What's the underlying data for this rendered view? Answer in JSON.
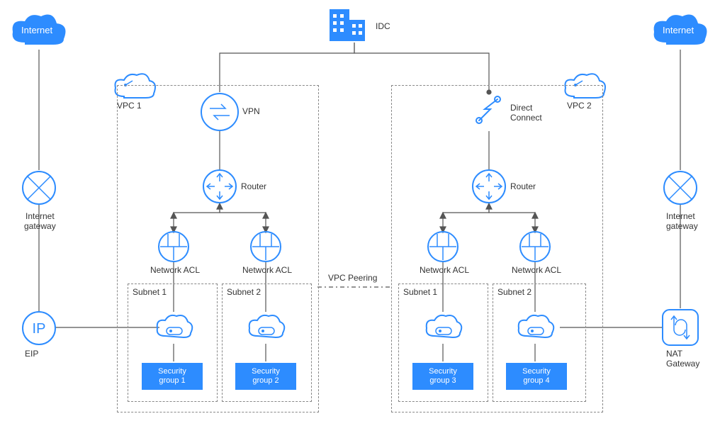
{
  "top": {
    "idc": "IDC"
  },
  "left": {
    "internet": "Internet",
    "gateway": "Internet\ngateway",
    "eip": "EIP"
  },
  "right": {
    "internet": "Internet",
    "gateway": "Internet\ngateway",
    "nat": "NAT\nGateway"
  },
  "vpc1": {
    "title": "VPC 1",
    "vpn": "VPN",
    "router": "Router",
    "acl1": "Network ACL",
    "acl2": "Network ACL",
    "subnet1": "Subnet 1",
    "subnet2": "Subnet 2",
    "sg1": "Security\ngroup 1",
    "sg2": "Security\ngroup 2"
  },
  "vpc2": {
    "title": "VPC 2",
    "dc": "Direct\nConnect",
    "router": "Router",
    "acl1": "Network ACL",
    "acl2": "Network ACL",
    "subnet1": "Subnet 1",
    "subnet2": "Subnet 2",
    "sg3": "Security\ngroup 3",
    "sg4": "Security\ngroup 4"
  },
  "middle": {
    "peering": "VPC Peering"
  }
}
